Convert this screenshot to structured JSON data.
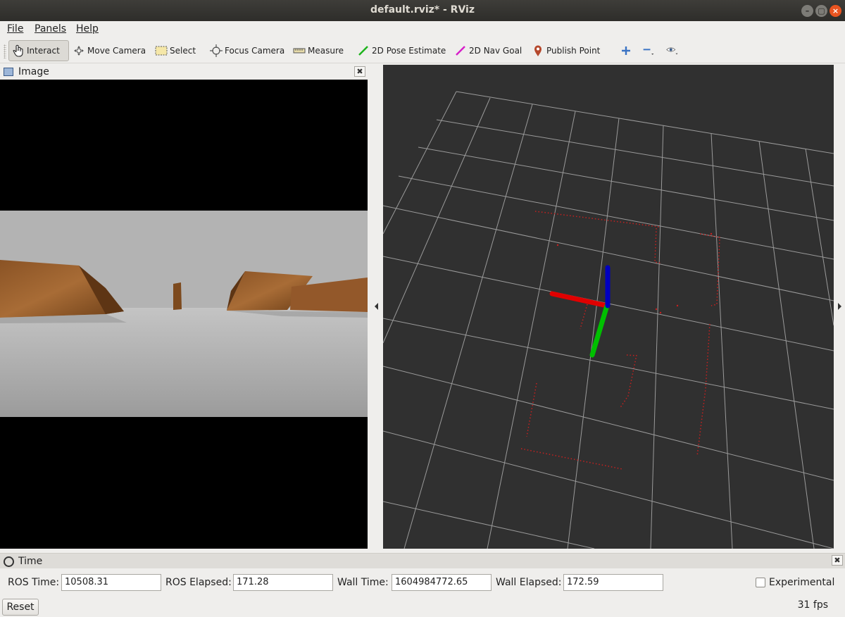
{
  "window": {
    "title": "default.rviz* - RViz"
  },
  "menu": {
    "file": "File",
    "panels": "Panels",
    "help": "Help"
  },
  "toolbar": {
    "interact": "Interact",
    "move_camera": "Move Camera",
    "select": "Select",
    "focus_camera": "Focus Camera",
    "measure": "Measure",
    "pose_estimate": "2D Pose Estimate",
    "nav_goal": "2D Nav Goal",
    "publish_point": "Publish Point"
  },
  "image_panel": {
    "title": "Image"
  },
  "time_panel": {
    "title": "Time",
    "ros_time_label": "ROS Time:",
    "ros_time": "10508.31",
    "ros_elapsed_label": "ROS Elapsed:",
    "ros_elapsed": "171.28",
    "wall_time_label": "Wall Time:",
    "wall_time": "1604984772.65",
    "wall_elapsed_label": "Wall Elapsed:",
    "wall_elapsed": "172.59",
    "experimental_label": "Experimental",
    "experimental_checked": false,
    "reset_label": "Reset",
    "fps": "31 fps"
  },
  "colors": {
    "view_background": "#303030",
    "grid": "#a0a0a0",
    "laser_points": "#c8201f",
    "axis_x": "#e00000",
    "axis_y": "#00c000",
    "axis_z": "#0000c0"
  }
}
